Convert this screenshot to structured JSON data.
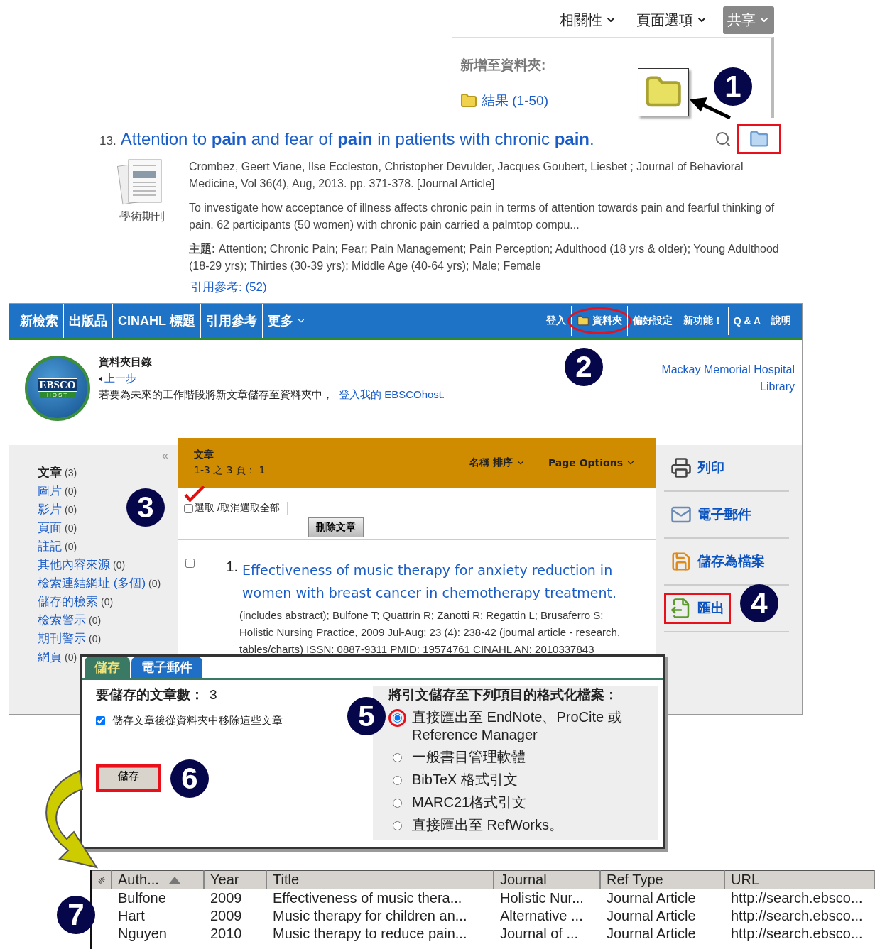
{
  "page_toolbar": {
    "items": [
      {
        "label": "相關性",
        "selected": false
      },
      {
        "label": "頁面選項",
        "selected": false
      },
      {
        "label": "共享",
        "selected": true
      }
    ]
  },
  "share_menu": {
    "heading": "新增至資料夾:",
    "folder_link": "結果 (1-50)"
  },
  "result": {
    "number": "13.",
    "title": "Attention to **pain** and fear of **pain** in patients with chronic **pain**.",
    "type_label": "學術期刊",
    "authors": "Crombez, Geert Viane, Ilse Eccleston, Christopher Devulder, Jacques Goubert, Liesbet ; Journal of Behavioral Medicine, Vol 36(4), Aug, 2013. pp. 371-378. [Journal Article]",
    "abstract": "To investigate how acceptance of illness affects chronic pain in terms of attention towards pain and fearful thinking of pain. 62 participants (50 women) with chronic pain carried a palmtop compu...",
    "subjects": "**主題:** Attention; Chronic Pain; Fear; Pain Management; Pain Perception; Adulthood (18 yrs & older); Young Adulthood (18-29 yrs); Thirties (30-39 yrs); Middle Age (40-64 yrs); Male; Female",
    "cited_refs": "引用參考: (52)",
    "add_to_folder_highlighted": true
  },
  "nav": {
    "left": [
      {
        "label": "新檢索",
        "dropdown": false
      },
      {
        "label": "出版品",
        "dropdown": false
      },
      {
        "label": "CINAHL 標題",
        "dropdown": false
      },
      {
        "label": "引用參考",
        "dropdown": false
      },
      {
        "label": "更多",
        "dropdown": true
      }
    ],
    "right": [
      {
        "label": "登入",
        "kind": "text",
        "highlighted": false
      },
      {
        "label": "資料夾",
        "kind": "folder",
        "highlighted": true
      },
      {
        "label": "偏好設定",
        "kind": "text",
        "highlighted": false
      },
      {
        "label": "新功能！",
        "kind": "text",
        "highlighted": false
      },
      {
        "label": "Q & A",
        "kind": "text",
        "highlighted": false
      },
      {
        "label": "說明",
        "kind": "text",
        "highlighted": false
      }
    ]
  },
  "folder_header": {
    "logo_top": "EBSCO",
    "logo_bottom": "HOST",
    "title": "資料夾目錄",
    "back": "上一步",
    "note": "若要為未來的工作階段將新文章儲存至資料夾中，",
    "login_link": "登入我的 EBSCOhost.",
    "library": "Mackay Memorial Hospital Library"
  },
  "sidebar": {
    "collapse": "«",
    "items": [
      {
        "label": "文章",
        "count": "(3)",
        "selected": true
      },
      {
        "label": "圖片",
        "count": "(0)",
        "selected": false
      },
      {
        "label": "影片",
        "count": "(0)",
        "selected": false
      },
      {
        "label": "頁面",
        "count": "(0)",
        "selected": false
      },
      {
        "label": "註記",
        "count": "(0)",
        "selected": false
      },
      {
        "label": "其他內容來源",
        "count": "(0)",
        "selected": false
      },
      {
        "label": "檢索連結網址 (多個)",
        "count": "(0)",
        "selected": false
      },
      {
        "label": "儲存的檢索",
        "count": "(0)",
        "selected": false
      },
      {
        "label": "檢索警示",
        "count": "(0)",
        "selected": false
      },
      {
        "label": "期刊警示",
        "count": "(0)",
        "selected": false
      },
      {
        "label": "網頁",
        "count": "(0)",
        "selected": false
      }
    ]
  },
  "folder_panel": {
    "heading": "文章",
    "pages": "1-3 之 3 頁： 1",
    "options": [
      "名稱 排序",
      "Page Options"
    ],
    "select_all": {
      "label": "選取 /取消選取全部",
      "checked": false
    },
    "delete_button": "刪除文章",
    "articles": [
      {
        "number": "1.",
        "checked": false,
        "title": "Effectiveness of music therapy for anxiety reduction in women with breast cancer in chemotherapy treatment.",
        "details": "(includes abstract); Bulfone T; Quattrin R; Zanotti R; Regattin L; Brusaferro S; Holistic Nursing Practice, 2009 Jul-Aug; 23 (4): 238-42 (journal article - research, tables/charts) ISSN: 0887-9311 PMID: 19574761 CINAHL AN: 2010337843"
      }
    ]
  },
  "actions": [
    {
      "label": "列印",
      "kind": "print",
      "highlighted": false
    },
    {
      "label": "電子郵件",
      "kind": "email",
      "highlighted": false
    },
    {
      "label": "儲存為檔案",
      "kind": "save",
      "highlighted": false
    },
    {
      "label": "匯出",
      "kind": "export",
      "highlighted": true
    }
  ],
  "dialog": {
    "tabs": [
      {
        "label": "儲存",
        "selected": true
      },
      {
        "label": "電子郵件",
        "selected": false
      }
    ],
    "count_label": "要儲存的文章數：",
    "count": "3",
    "remove_option": {
      "label": "儲存文章後從資料夾中移除這些文章",
      "checked": true
    },
    "save_button": "儲存",
    "format_heading": "將引文儲存至下列項目的格式化檔案：",
    "formats": [
      {
        "label": "直接匯出至 EndNote、ProCite 或 Reference Manager",
        "selected": true
      },
      {
        "label": "一般書目管理軟體",
        "selected": false
      },
      {
        "label": "BibTeX 格式引文",
        "selected": false
      },
      {
        "label": "MARC21格式引文",
        "selected": false
      },
      {
        "label": "直接匯出至 RefWorks。",
        "selected": false
      }
    ]
  },
  "reference_table": {
    "columns": [
      {
        "label": "Auth...",
        "sorted": true
      },
      {
        "label": "Year",
        "sorted": false
      },
      {
        "label": "Title",
        "sorted": false
      },
      {
        "label": "Journal",
        "sorted": false
      },
      {
        "label": "Ref Type",
        "sorted": false
      },
      {
        "label": "URL",
        "sorted": false
      }
    ],
    "rows": [
      [
        "Bulfone",
        "2009",
        "Effectiveness of music thera...",
        "Holistic Nur...",
        "Journal Article",
        "http://search.ebsco..."
      ],
      [
        "Hart",
        "2009",
        "Music therapy for children an...",
        "Alternative ...",
        "Journal Article",
        "http://search.ebsco..."
      ],
      [
        "Nguyen",
        "2010",
        "Music therapy to reduce pain...",
        "Journal of ...",
        "Journal Article",
        "http://search.ebsco..."
      ]
    ]
  },
  "callouts": [
    "1",
    "2",
    "3",
    "4",
    "5",
    "6",
    "7"
  ]
}
